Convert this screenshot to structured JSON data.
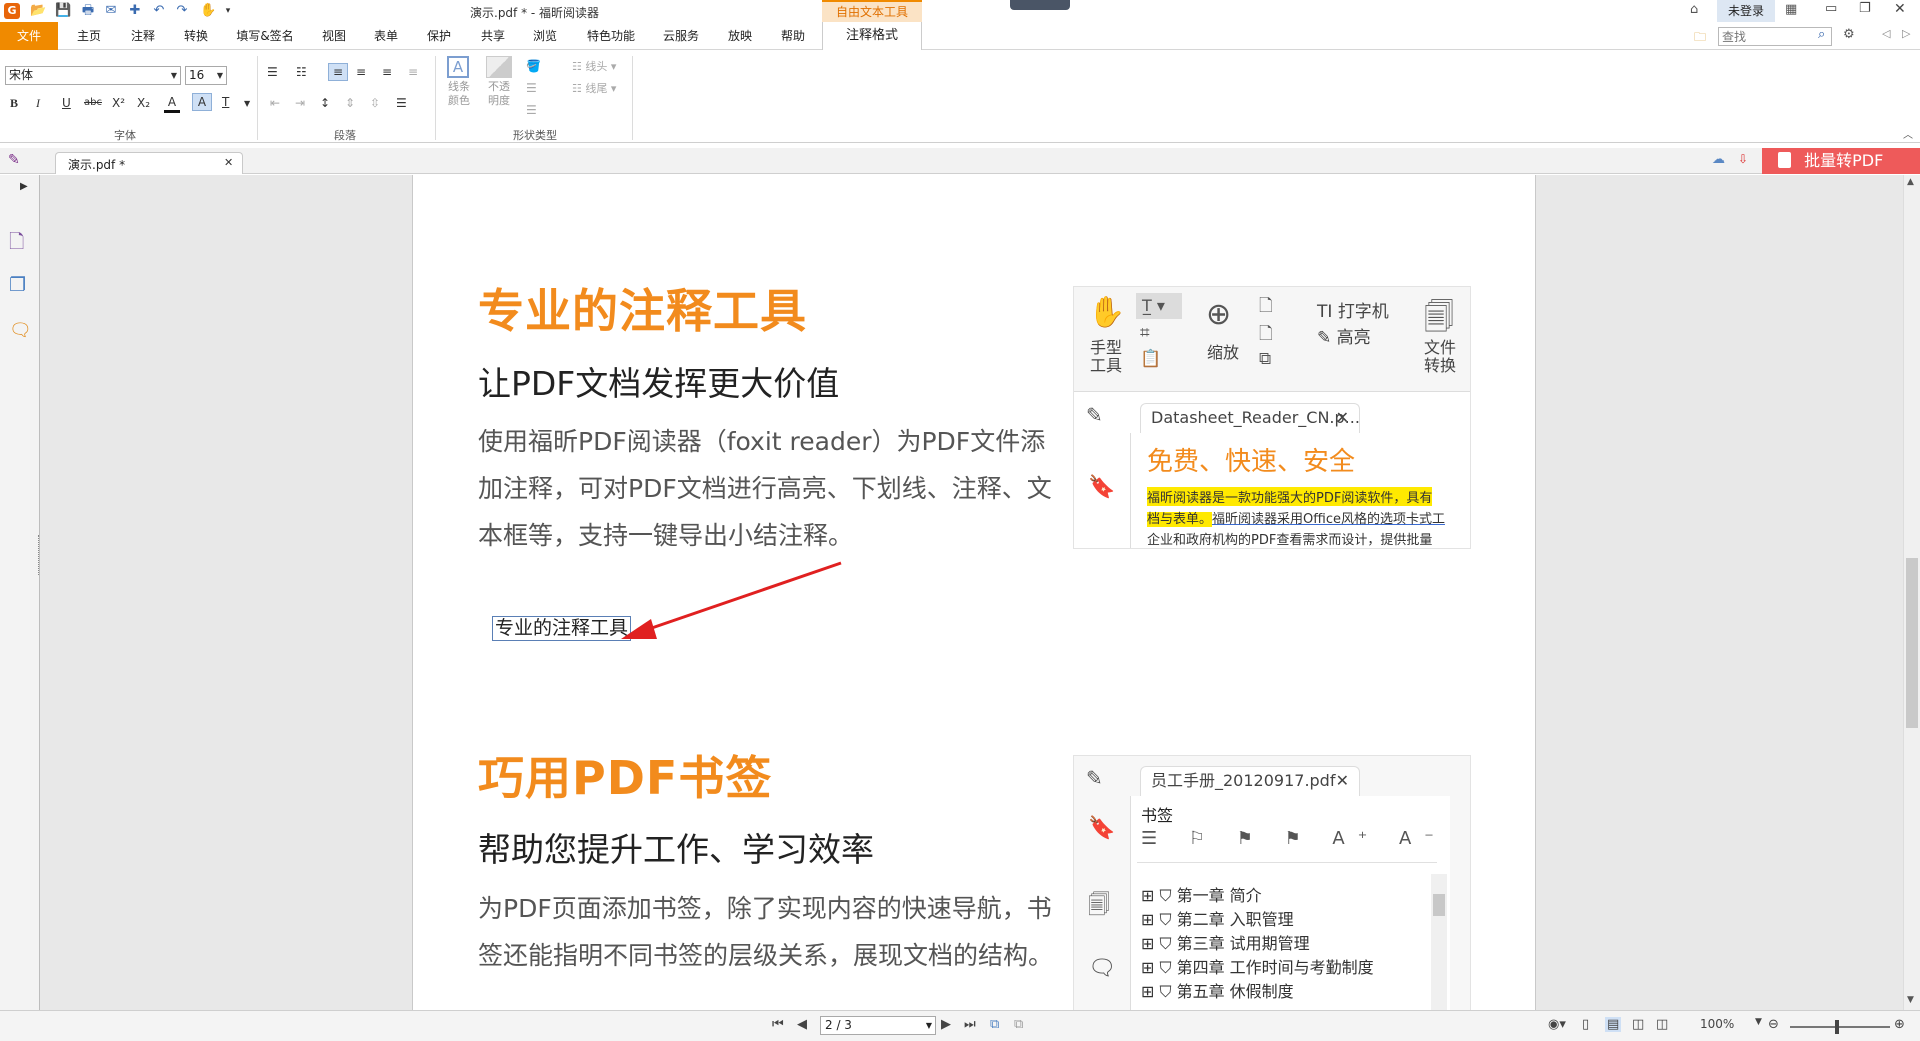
{
  "title": "演示.pdf * - 福昕阅读器",
  "context_tab": "自由文本工具",
  "login": "未登录",
  "search_placeholder": "查找",
  "menu": [
    "文件",
    "主页",
    "注释",
    "转换",
    "填写&签名",
    "视图",
    "表单",
    "保护",
    "共享",
    "浏览",
    "特色功能",
    "云服务",
    "放映",
    "帮助",
    "注释格式"
  ],
  "font": {
    "name": "宋体",
    "size": "16"
  },
  "ribbon": {
    "font_group": "字体",
    "para_group": "段落",
    "shape_group": "形状类型",
    "line_color": "线条\n颜色",
    "opacity": "不透\n明度",
    "line_start": "线头",
    "line_end": "线尾"
  },
  "doc_tab": "演示.pdf *",
  "batch_convert": "批量转PDF",
  "page": {
    "s1_title": "专业的注释工具",
    "s1_subtitle": "让PDF文档发挥更大价值",
    "s1_body": "使用福昕PDF阅读器（foxit reader）为PDF文件添加注释，可对PDF文档进行高亮、下划线、注释、文本框等，支持一键导出小结注释。",
    "annotation": "专业的注释工具",
    "s2_title": "巧用PDF书签",
    "s2_subtitle": "帮助您提升工作、学习效率",
    "s2_body": "为PDF页面添加书签，除了实现内容的快速导航，书签还能指明不同书签的层级关系，展现文档的结构。"
  },
  "shot1": {
    "hand": "手型\n工具",
    "zoom": "缩放",
    "typewriter": "打字机",
    "highlight": "高亮",
    "convert": "文件\n转换",
    "tab": "Datasheet_Reader_CN.p...",
    "heading": "免费、快速、安全",
    "line1": "福昕阅读器是一款功能强大的PDF阅读软件，具有",
    "line2a": "档与表单。",
    "line2b": "福昕阅读器采用Office风格的选项卡式工",
    "line3": "企业和政府机构的PDF查看需求而设计，提供批量"
  },
  "shot2": {
    "tab": "员工手册_20120917.pdf",
    "panel_title": "书签",
    "bookmarks": [
      "第一章  简介",
      "第二章  入职管理",
      "第三章  试用期管理",
      "第四章  工作时间与考勤制度",
      "第五章  休假制度"
    ]
  },
  "status": {
    "page": "2 / 3",
    "zoom": "100%"
  }
}
